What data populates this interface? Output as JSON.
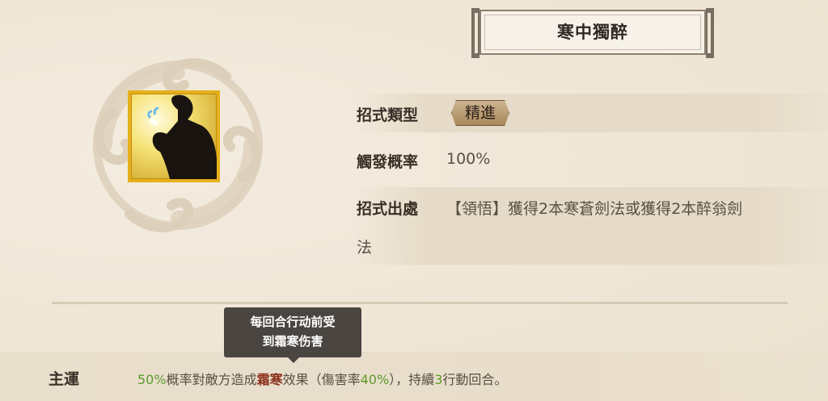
{
  "skill": {
    "title": "寒中獨醉",
    "type_label": "招式類型",
    "type_value": "精進",
    "trigger_label": "觸發概率",
    "trigger_value": "100%",
    "source_label": "招式出處",
    "source_line1": "【領悟】獲得2本寒蒼劍法或獲得2本醉翁劍",
    "source_line2": "法"
  },
  "tooltip": {
    "line1": "每回合行动前受",
    "line2": "到霜寒伤害"
  },
  "main": {
    "label": "主運",
    "effect_rate": "50%",
    "effect_t1": "概率對敵方造成",
    "effect_status": "霜寒",
    "effect_t2": "效果（傷害率",
    "effect_dmg": "40%",
    "effect_t3": "），持續",
    "effect_turns": "3",
    "effect_t4": "行動回合。"
  },
  "icons": {
    "emblem": "cloud-swirl-emblem",
    "skill": "drinking-swordsman-icon"
  },
  "colors": {
    "background": "#efe6d6",
    "icon_border": "#e6b01c",
    "highlight_green": "#5e9a2a",
    "highlight_red": "#8a2e1a",
    "tooltip_bg": "#4a4541"
  }
}
